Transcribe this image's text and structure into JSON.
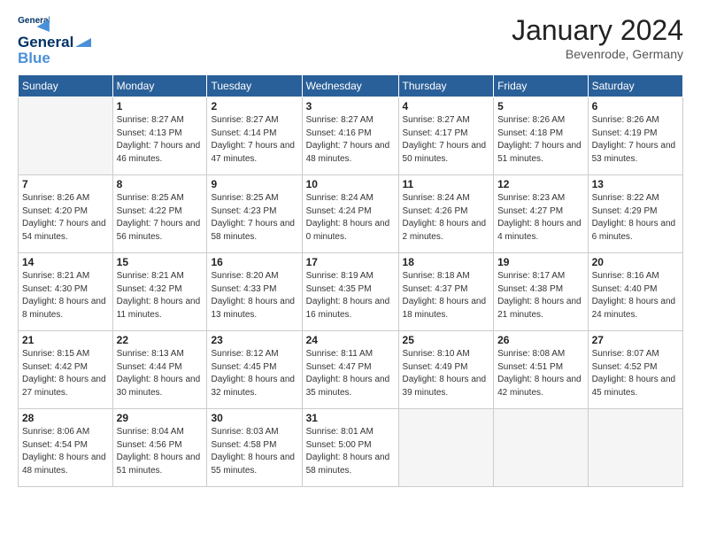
{
  "header": {
    "logo_line1": "General",
    "logo_line2": "Blue",
    "month": "January 2024",
    "location": "Bevenrode, Germany"
  },
  "days_of_week": [
    "Sunday",
    "Monday",
    "Tuesday",
    "Wednesday",
    "Thursday",
    "Friday",
    "Saturday"
  ],
  "weeks": [
    [
      {
        "day": "",
        "sunrise": "",
        "sunset": "",
        "daylight": "",
        "empty": true
      },
      {
        "day": "1",
        "sunrise": "Sunrise: 8:27 AM",
        "sunset": "Sunset: 4:13 PM",
        "daylight": "Daylight: 7 hours and 46 minutes."
      },
      {
        "day": "2",
        "sunrise": "Sunrise: 8:27 AM",
        "sunset": "Sunset: 4:14 PM",
        "daylight": "Daylight: 7 hours and 47 minutes."
      },
      {
        "day": "3",
        "sunrise": "Sunrise: 8:27 AM",
        "sunset": "Sunset: 4:16 PM",
        "daylight": "Daylight: 7 hours and 48 minutes."
      },
      {
        "day": "4",
        "sunrise": "Sunrise: 8:27 AM",
        "sunset": "Sunset: 4:17 PM",
        "daylight": "Daylight: 7 hours and 50 minutes."
      },
      {
        "day": "5",
        "sunrise": "Sunrise: 8:26 AM",
        "sunset": "Sunset: 4:18 PM",
        "daylight": "Daylight: 7 hours and 51 minutes."
      },
      {
        "day": "6",
        "sunrise": "Sunrise: 8:26 AM",
        "sunset": "Sunset: 4:19 PM",
        "daylight": "Daylight: 7 hours and 53 minutes."
      }
    ],
    [
      {
        "day": "7",
        "sunrise": "Sunrise: 8:26 AM",
        "sunset": "Sunset: 4:20 PM",
        "daylight": "Daylight: 7 hours and 54 minutes."
      },
      {
        "day": "8",
        "sunrise": "Sunrise: 8:25 AM",
        "sunset": "Sunset: 4:22 PM",
        "daylight": "Daylight: 7 hours and 56 minutes."
      },
      {
        "day": "9",
        "sunrise": "Sunrise: 8:25 AM",
        "sunset": "Sunset: 4:23 PM",
        "daylight": "Daylight: 7 hours and 58 minutes."
      },
      {
        "day": "10",
        "sunrise": "Sunrise: 8:24 AM",
        "sunset": "Sunset: 4:24 PM",
        "daylight": "Daylight: 8 hours and 0 minutes."
      },
      {
        "day": "11",
        "sunrise": "Sunrise: 8:24 AM",
        "sunset": "Sunset: 4:26 PM",
        "daylight": "Daylight: 8 hours and 2 minutes."
      },
      {
        "day": "12",
        "sunrise": "Sunrise: 8:23 AM",
        "sunset": "Sunset: 4:27 PM",
        "daylight": "Daylight: 8 hours and 4 minutes."
      },
      {
        "day": "13",
        "sunrise": "Sunrise: 8:22 AM",
        "sunset": "Sunset: 4:29 PM",
        "daylight": "Daylight: 8 hours and 6 minutes."
      }
    ],
    [
      {
        "day": "14",
        "sunrise": "Sunrise: 8:21 AM",
        "sunset": "Sunset: 4:30 PM",
        "daylight": "Daylight: 8 hours and 8 minutes."
      },
      {
        "day": "15",
        "sunrise": "Sunrise: 8:21 AM",
        "sunset": "Sunset: 4:32 PM",
        "daylight": "Daylight: 8 hours and 11 minutes."
      },
      {
        "day": "16",
        "sunrise": "Sunrise: 8:20 AM",
        "sunset": "Sunset: 4:33 PM",
        "daylight": "Daylight: 8 hours and 13 minutes."
      },
      {
        "day": "17",
        "sunrise": "Sunrise: 8:19 AM",
        "sunset": "Sunset: 4:35 PM",
        "daylight": "Daylight: 8 hours and 16 minutes."
      },
      {
        "day": "18",
        "sunrise": "Sunrise: 8:18 AM",
        "sunset": "Sunset: 4:37 PM",
        "daylight": "Daylight: 8 hours and 18 minutes."
      },
      {
        "day": "19",
        "sunrise": "Sunrise: 8:17 AM",
        "sunset": "Sunset: 4:38 PM",
        "daylight": "Daylight: 8 hours and 21 minutes."
      },
      {
        "day": "20",
        "sunrise": "Sunrise: 8:16 AM",
        "sunset": "Sunset: 4:40 PM",
        "daylight": "Daylight: 8 hours and 24 minutes."
      }
    ],
    [
      {
        "day": "21",
        "sunrise": "Sunrise: 8:15 AM",
        "sunset": "Sunset: 4:42 PM",
        "daylight": "Daylight: 8 hours and 27 minutes."
      },
      {
        "day": "22",
        "sunrise": "Sunrise: 8:13 AM",
        "sunset": "Sunset: 4:44 PM",
        "daylight": "Daylight: 8 hours and 30 minutes."
      },
      {
        "day": "23",
        "sunrise": "Sunrise: 8:12 AM",
        "sunset": "Sunset: 4:45 PM",
        "daylight": "Daylight: 8 hours and 32 minutes."
      },
      {
        "day": "24",
        "sunrise": "Sunrise: 8:11 AM",
        "sunset": "Sunset: 4:47 PM",
        "daylight": "Daylight: 8 hours and 35 minutes."
      },
      {
        "day": "25",
        "sunrise": "Sunrise: 8:10 AM",
        "sunset": "Sunset: 4:49 PM",
        "daylight": "Daylight: 8 hours and 39 minutes."
      },
      {
        "day": "26",
        "sunrise": "Sunrise: 8:08 AM",
        "sunset": "Sunset: 4:51 PM",
        "daylight": "Daylight: 8 hours and 42 minutes."
      },
      {
        "day": "27",
        "sunrise": "Sunrise: 8:07 AM",
        "sunset": "Sunset: 4:52 PM",
        "daylight": "Daylight: 8 hours and 45 minutes."
      }
    ],
    [
      {
        "day": "28",
        "sunrise": "Sunrise: 8:06 AM",
        "sunset": "Sunset: 4:54 PM",
        "daylight": "Daylight: 8 hours and 48 minutes."
      },
      {
        "day": "29",
        "sunrise": "Sunrise: 8:04 AM",
        "sunset": "Sunset: 4:56 PM",
        "daylight": "Daylight: 8 hours and 51 minutes."
      },
      {
        "day": "30",
        "sunrise": "Sunrise: 8:03 AM",
        "sunset": "Sunset: 4:58 PM",
        "daylight": "Daylight: 8 hours and 55 minutes."
      },
      {
        "day": "31",
        "sunrise": "Sunrise: 8:01 AM",
        "sunset": "Sunset: 5:00 PM",
        "daylight": "Daylight: 8 hours and 58 minutes."
      },
      {
        "day": "",
        "sunrise": "",
        "sunset": "",
        "daylight": "",
        "empty": true
      },
      {
        "day": "",
        "sunrise": "",
        "sunset": "",
        "daylight": "",
        "empty": true
      },
      {
        "day": "",
        "sunrise": "",
        "sunset": "",
        "daylight": "",
        "empty": true
      }
    ]
  ]
}
